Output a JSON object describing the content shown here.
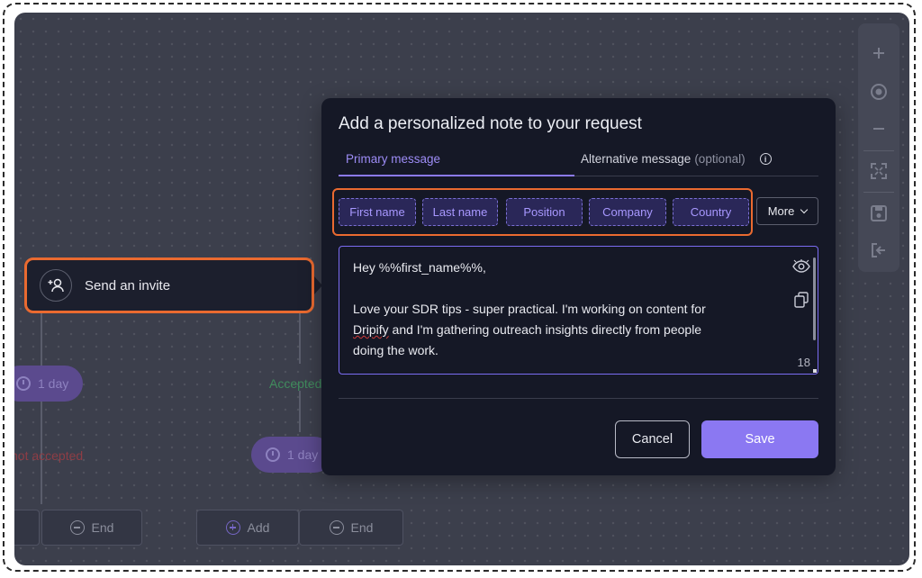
{
  "workflow": {
    "node_label": "Send an invite",
    "delay_left": "1 day",
    "delay_middle": "1 day",
    "label_accepted": "Accepted",
    "label_not_accepted": "not accepted",
    "add_label": "Add",
    "end_label_left": "End",
    "end_label_right": "End"
  },
  "toolbar": {
    "icons": [
      "plus-icon",
      "target-icon",
      "minus-icon",
      "fullscreen-icon",
      "save-icon",
      "exit-icon"
    ]
  },
  "modal": {
    "title": "Add a personalized note to your request",
    "tabs": {
      "primary": "Primary message",
      "alternative": "Alternative message",
      "alternative_hint": "(optional)"
    },
    "variables": [
      "First name",
      "Last name",
      "Position",
      "Company",
      "Country"
    ],
    "more_label": "More",
    "message_lines": [
      "Hey %%first_name%%,",
      "",
      "Love your SDR tips - super practical. I'm working on content for",
      "Dripify and I'm gathering outreach insights directly from people",
      "doing the work."
    ],
    "message_prefix_word": "Dripify",
    "message_line4_rest": " and I'm gathering outreach insights directly from people",
    "char_count": "18",
    "cancel_label": "Cancel",
    "save_label": "Save"
  },
  "colors": {
    "accent": "#8b78f2",
    "highlight": "#ea6a30",
    "modal_bg": "#151826",
    "canvas_bg": "#3c3f4c"
  }
}
